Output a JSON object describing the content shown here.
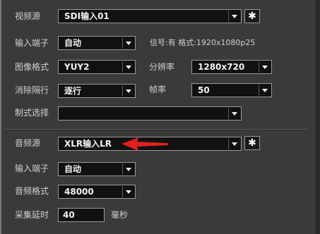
{
  "video": {
    "source": {
      "label": "视频源",
      "value": "SDI输入01"
    },
    "input_port": {
      "label": "输入端子",
      "value": "自动",
      "info": "信号:有 格式:1920x1080p25"
    },
    "image_format": {
      "label": "图像格式",
      "value": "YUY2"
    },
    "resolution": {
      "label": "分辨率",
      "value": "1280x720"
    },
    "deinterlace": {
      "label": "消除隔行",
      "value": "逐行"
    },
    "frame_rate": {
      "label": "帧率",
      "value": "50"
    },
    "standard": {
      "label": "制式选择",
      "value": ""
    }
  },
  "audio": {
    "source": {
      "label": "音频源",
      "value": "XLR输入LR"
    },
    "input_port": {
      "label": "输入端子",
      "value": "自动"
    },
    "format": {
      "label": "音频格式",
      "value": "48000"
    },
    "delay": {
      "label": "采集延时",
      "value": "40",
      "unit": "毫秒"
    }
  },
  "icons": {
    "settings": "gear-icon",
    "dropdown": "chevron-down-icon",
    "annotation": "red-arrow"
  },
  "colors": {
    "background": "#3a3a3a",
    "field": "#111111",
    "annotation": "#e02020"
  }
}
